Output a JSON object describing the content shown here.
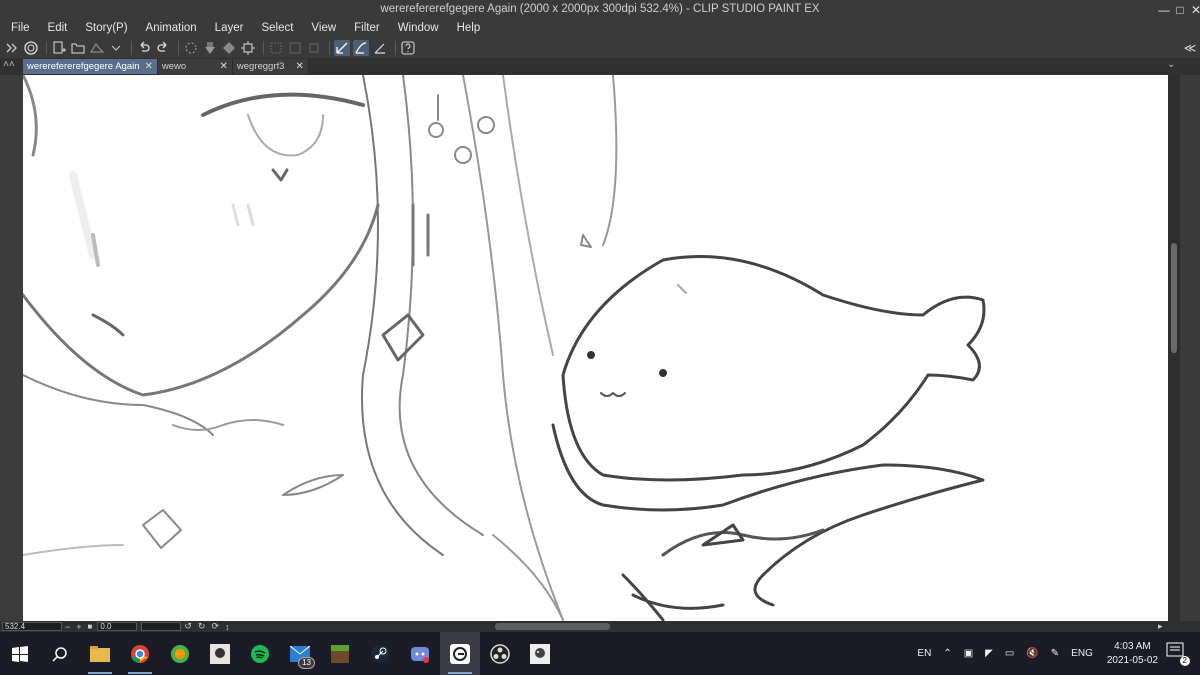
{
  "window": {
    "title": "wererefererefgegere Again (2000 x 2000px 300dpi 532.4%)  - CLIP STUDIO PAINT EX",
    "menu": [
      "File",
      "Edit",
      "Story(P)",
      "Animation",
      "Layer",
      "Select",
      "View",
      "Filter",
      "Window",
      "Help"
    ]
  },
  "toolbar": {
    "icons": [
      "expand-arrows-icon",
      "clip-studio-icon",
      "new-canvas-icon",
      "open-folder-icon",
      "save-icon",
      "dropdown-icon",
      "undo-icon",
      "redo-icon",
      "loading-icon",
      "fill-icon",
      "transform-icon",
      "clear-icon",
      "select-all-icon",
      "deselect-icon",
      "snap-ruler-icon",
      "snap-special-ruler-icon",
      "snap-grid-icon",
      "help-icon"
    ]
  },
  "tabs": [
    {
      "label": "wererefererefgegere Again",
      "active": true
    },
    {
      "label": "wewo",
      "active": false
    },
    {
      "label": "wegreggrf3",
      "active": false
    }
  ],
  "status": {
    "zoom": "532.4",
    "rotation": "0.0"
  },
  "taskbar": {
    "apps": [
      "start-icon",
      "search-icon",
      "file-explorer-icon",
      "chrome-icon",
      "game-icon",
      "app-icon",
      "spotify-icon",
      "mail-icon",
      "minecraft-icon",
      "steam-icon",
      "discord-icon",
      "clip-studio-icon",
      "obs-icon",
      "app2-icon"
    ],
    "mail_badge": "13",
    "tray": {
      "lang": "EN",
      "input": "ENG",
      "time": "4:03 AM",
      "date": "2021-05-02",
      "notif_count": "2"
    }
  }
}
